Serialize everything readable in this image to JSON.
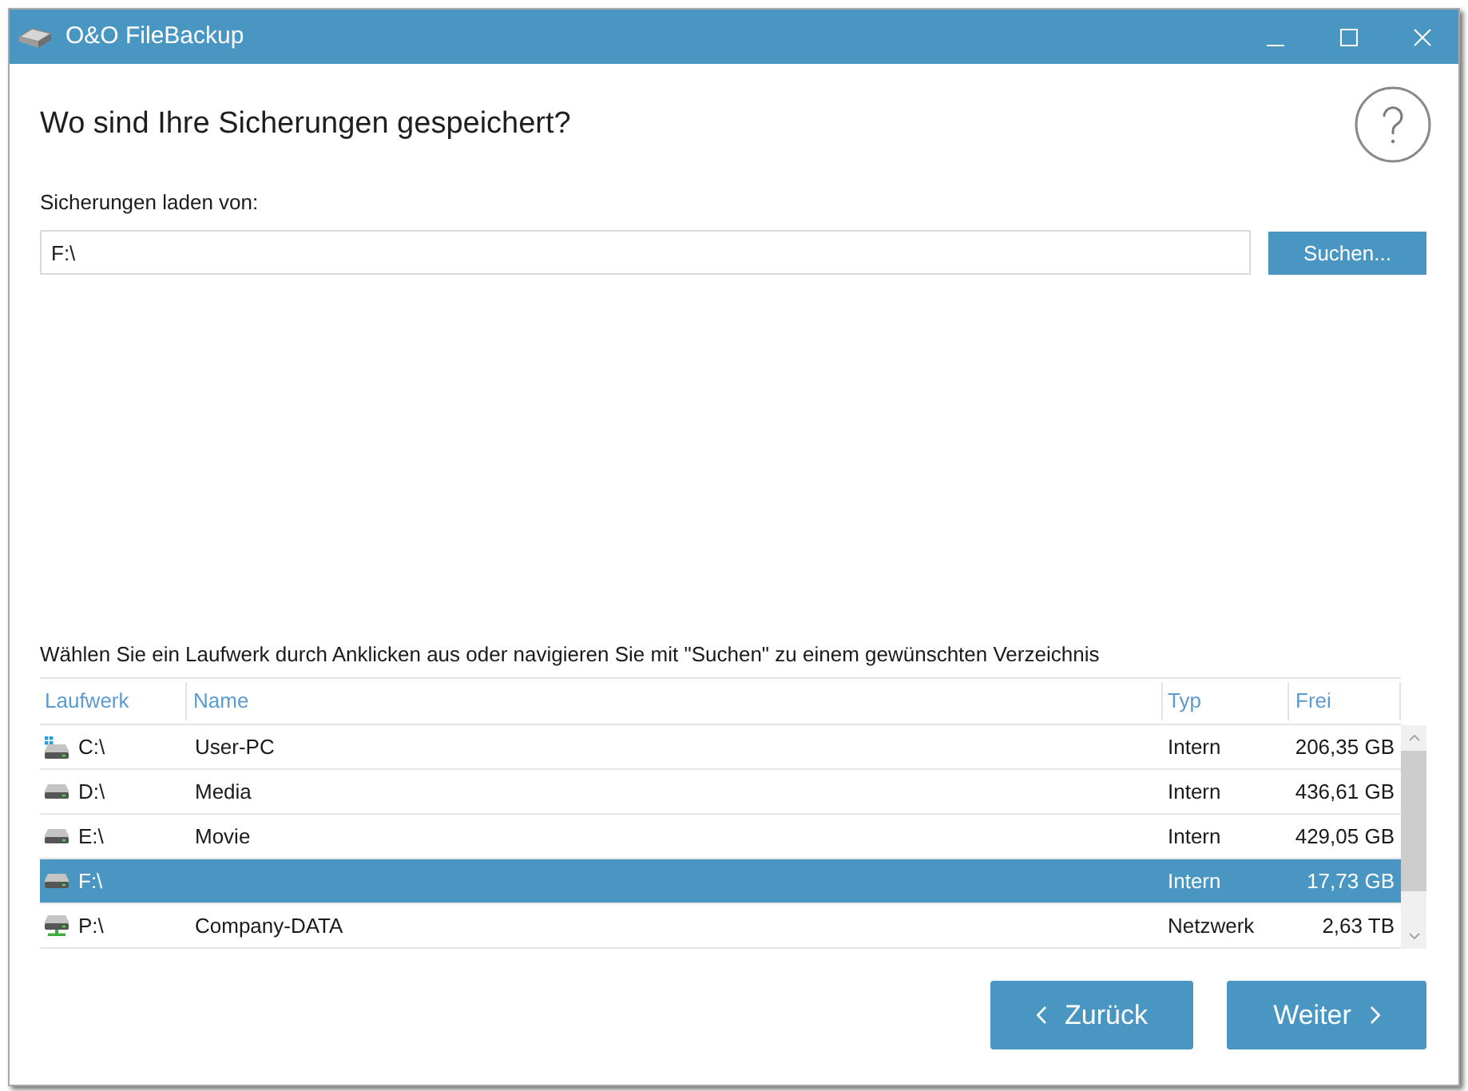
{
  "window": {
    "title": "O&O FileBackup"
  },
  "heading": "Wo sind Ihre Sicherungen gespeichert?",
  "source": {
    "label": "Sicherungen laden von:",
    "value": "F:\\",
    "button": "Suchen..."
  },
  "drives": {
    "instruction": "Wählen Sie ein Laufwerk durch Anklicken aus oder navigieren Sie mit \"Suchen\" zu einem gewünschten Verzeichnis",
    "columns": [
      "Laufwerk",
      "Name",
      "Typ",
      "Frei"
    ],
    "rows": [
      {
        "kind": "system",
        "drive": "C:\\",
        "name": "User-PC",
        "type": "Intern",
        "free": "206,35 GB",
        "selected": false
      },
      {
        "kind": "drive",
        "drive": "D:\\",
        "name": "Media",
        "type": "Intern",
        "free": "436,61 GB",
        "selected": false
      },
      {
        "kind": "drive",
        "drive": "E:\\",
        "name": "Movie",
        "type": "Intern",
        "free": "429,05 GB",
        "selected": false
      },
      {
        "kind": "drive",
        "drive": "F:\\",
        "type": "Intern",
        "free": "17,73 GB",
        "selected": true
      },
      {
        "kind": "network",
        "drive": "P:\\",
        "name": "Company-DATA",
        "type": "Netzwerk",
        "free": "2,63 TB",
        "selected": false
      }
    ]
  },
  "navigation": [
    {
      "kind": "back",
      "label": "Zurück"
    },
    {
      "kind": "next",
      "label": "Weiter"
    }
  ]
}
